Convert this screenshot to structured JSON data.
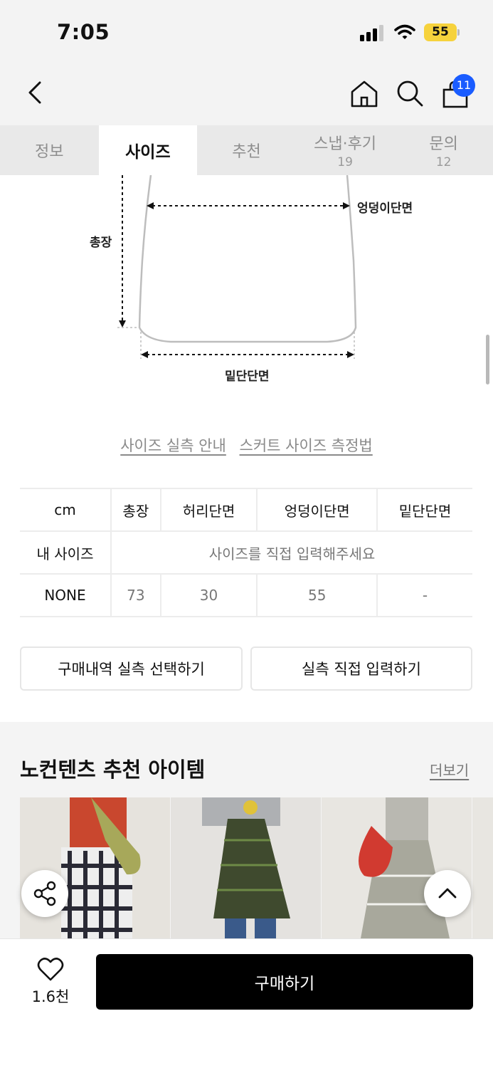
{
  "status": {
    "time": "7:05",
    "battery": "55"
  },
  "header": {
    "back_icon": "chevron-left-icon",
    "home_icon": "home-icon",
    "search_icon": "search-icon",
    "cart_icon": "shopping-bag-icon",
    "cart_badge": "11"
  },
  "tabs": [
    {
      "label": "정보",
      "count": ""
    },
    {
      "label": "사이즈",
      "count": ""
    },
    {
      "label": "추천",
      "count": ""
    },
    {
      "label": "스냅·후기",
      "count": "19"
    },
    {
      "label": "문의",
      "count": "12"
    }
  ],
  "active_tab": "사이즈",
  "diagram": {
    "hip_label": "엉덩이단면",
    "length_label": "총장",
    "hem_label": "밑단단면"
  },
  "guide_links": {
    "size_guide": "사이즈 실측 안내",
    "skirt_measure": "스커트 사이즈 측정법"
  },
  "size_table": {
    "headers": [
      "cm",
      "총장",
      "허리단면",
      "엉덩이단면",
      "밑단단면"
    ],
    "my_size_label": "내 사이즈",
    "my_size_prompt": "사이즈를 직접 입력해주세요",
    "rows": [
      {
        "name": "NONE",
        "values": [
          "73",
          "30",
          "55",
          "-"
        ]
      }
    ]
  },
  "buttons": {
    "purchase_history": "구매내역 실측 선택하기",
    "manual_input": "실측 직접 입력하기"
  },
  "recommend": {
    "title": "노컨텐츠 추천 아이템",
    "more": "더보기"
  },
  "bottom": {
    "like_count": "1.6천",
    "buy_label": "구매하기"
  },
  "colors": {
    "accent_badge": "#1a5cff",
    "buy_button": "#000000",
    "battery": "#f6d23c"
  }
}
